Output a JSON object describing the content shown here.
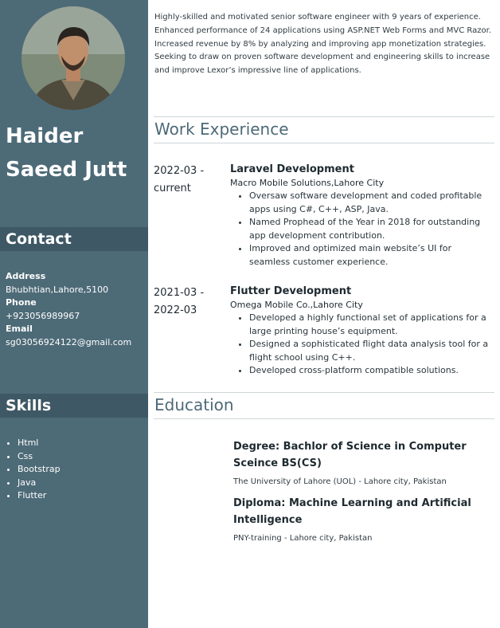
{
  "profile": {
    "first_name": "Haider",
    "last_name": "Saeed Jutt",
    "summary": "Highly-skilled and motivated senior software engineer with 9 years of experience. Enhanced performance of 24 applications using ASP.NET Web Forms and MVC Razor. Increased revenue by 8% by analyzing and improving app monetization strategies. Seeking to draw on proven software development and engineering skills to increase and improve Lexor’s impressive line of applications."
  },
  "contact": {
    "heading": "Contact",
    "address_label": "Address",
    "address": "Bhubhtian,Lahore,5100",
    "phone_label": "Phone",
    "phone": "+923056989967",
    "email_label": "Email",
    "email": "sg03056924122@gmail.com"
  },
  "skills": {
    "heading": "Skills",
    "items": [
      "Html",
      "Css",
      "Bootstrap",
      "Java",
      "Flutter"
    ]
  },
  "work": {
    "heading": "Work Experience",
    "jobs": [
      {
        "date_start": "2022-03 -",
        "date_end": "current",
        "title": "Laravel Development",
        "company": "Macro Mobile Solutions,Lahore City",
        "bullets": [
          "Oversaw software development and coded profitable apps using C#, C++, ASP, Java.",
          "Named Prophead of the Year in 2018 for outstanding app development contribution.",
          "Improved and optimized main website’s UI for seamless customer experience."
        ]
      },
      {
        "date_start": "2021-03 -",
        "date_end": "2022-03",
        "title": "Flutter Development",
        "company": "Omega Mobile Co.,Lahore City",
        "bullets": [
          "Developed a highly functional set of applications for a large printing house’s equipment.",
          "Designed a sophisticated flight data analysis tool for a flight school using C++.",
          "Developed cross-platform compatible solutions."
        ]
      }
    ]
  },
  "education": {
    "heading": "Education",
    "entries": [
      {
        "degree": "Degree: Bachlor of Science in Computer Sceince BS(CS)",
        "school": "The University of Lahore (UOL) - Lahore city, Pakistan"
      },
      {
        "degree": "Diploma: Machine Learning and Artificial Intelligence",
        "school": "PNY-training - Lahore city, Pakistan"
      }
    ]
  }
}
